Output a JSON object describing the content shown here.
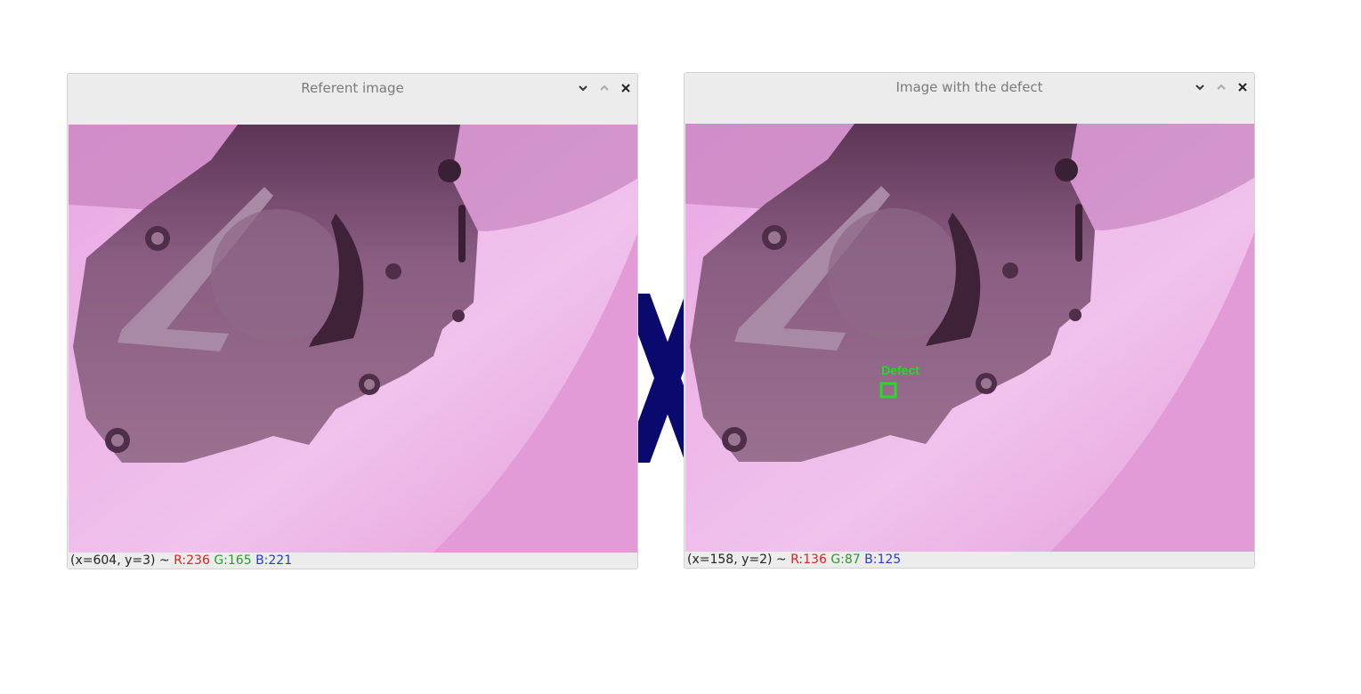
{
  "windows": {
    "reference": {
      "title": "Referent image",
      "status": {
        "coords": "(x=604, y=3) ~ ",
        "r": "R:236",
        "g": "G:165",
        "b": "B:221"
      }
    },
    "defect": {
      "title": "Image with the defect",
      "defect_label": "Defect",
      "status": {
        "coords": "(x=158, y=2) ~ ",
        "r": "R:136",
        "g": "G:87",
        "b": "B:125"
      }
    }
  },
  "icons": {
    "minimize": "chevron-down-icon",
    "maximize": "chevron-up-icon",
    "close": "close-icon"
  },
  "colors": {
    "title_bar": "#ececec",
    "defect_box": "#22dd22",
    "background_cross": "#0a0a6e",
    "status_red": "#e02020",
    "status_green": "#2a9a2a",
    "status_blue": "#2a3ad0"
  }
}
